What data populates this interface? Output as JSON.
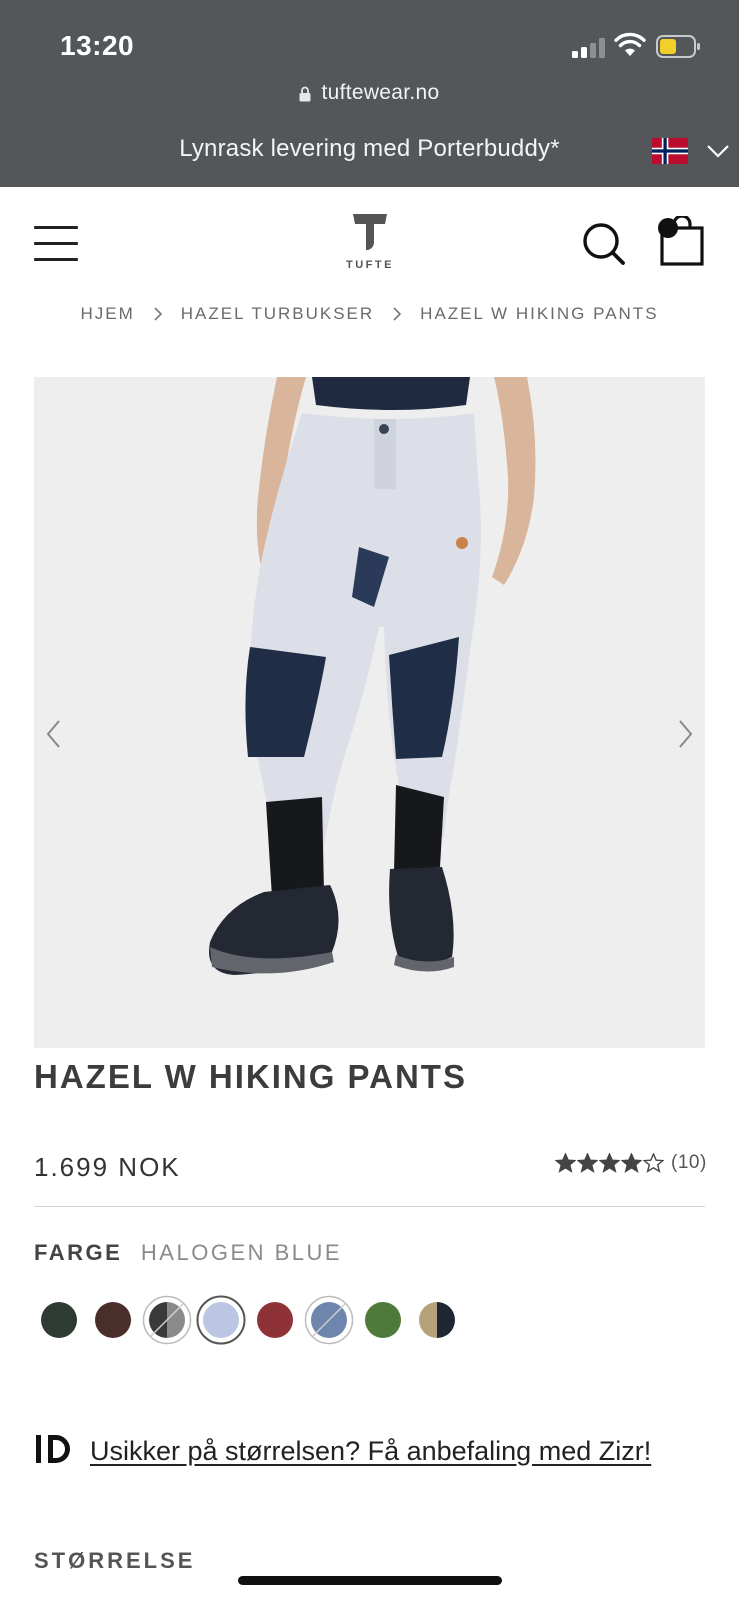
{
  "status_bar": {
    "time": "13:20"
  },
  "browser": {
    "url": "tuftewear.no"
  },
  "promo": {
    "text": "Lynrask levering med Porterbuddy*",
    "country": "NO"
  },
  "header": {
    "logo_text": "TUFTE"
  },
  "breadcrumb": [
    "HJEM",
    "HAZEL TURBUKSER",
    "HAZEL W HIKING PANTS"
  ],
  "product": {
    "brand": "HAZEL",
    "name": "W HIKING PANTS",
    "price": "1.699 NOK",
    "rating_stars": 4,
    "rating_max": 5,
    "review_count": "(10)"
  },
  "color": {
    "label": "FARGE",
    "selected": "HALOGEN BLUE",
    "swatches": [
      {
        "colors": [
          "#2e3b33"
        ],
        "selected": false,
        "unavailable": false
      },
      {
        "colors": [
          "#4a2e2a"
        ],
        "selected": false,
        "unavailable": false
      },
      {
        "colors": [
          "#3a3a3a",
          "#8a8a8a"
        ],
        "selected": false,
        "unavailable": true
      },
      {
        "colors": [
          "#bac6e3"
        ],
        "selected": true,
        "unavailable": false
      },
      {
        "colors": [
          "#8e3238"
        ],
        "selected": false,
        "unavailable": false
      },
      {
        "colors": [
          "#6e85ad"
        ],
        "selected": false,
        "unavailable": true
      },
      {
        "colors": [
          "#4f7a39"
        ],
        "selected": false,
        "unavailable": false
      },
      {
        "colors": [
          "#b5a27a",
          "#1e2533"
        ],
        "selected": false,
        "unavailable": false
      }
    ]
  },
  "size_help": {
    "link_text": "Usikker på størrelsen? Få anbefaling med Zizr!"
  },
  "size": {
    "label": "STØRRELSE"
  }
}
